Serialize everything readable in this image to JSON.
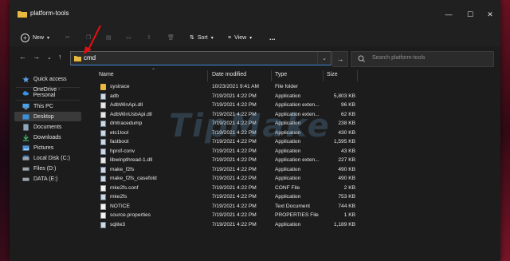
{
  "window": {
    "title": "platform-tools"
  },
  "toolbar": {
    "new_label": "New",
    "sort_label": "Sort",
    "view_label": "View",
    "more_label": "..."
  },
  "address": {
    "path": "cmd",
    "search_placeholder": "Search platform-tools"
  },
  "sidebar": {
    "items": [
      {
        "label": "Quick access",
        "icon": "star-icon"
      },
      {
        "label": "OneDrive - Personal",
        "icon": "cloud-icon"
      },
      {
        "label": "This PC",
        "icon": "pc-icon"
      },
      {
        "label": "Desktop",
        "icon": "desktop-icon"
      },
      {
        "label": "Documents",
        "icon": "documents-icon"
      },
      {
        "label": "Downloads",
        "icon": "downloads-icon"
      },
      {
        "label": "Pictures",
        "icon": "pictures-icon"
      },
      {
        "label": "Local Disk (C:)",
        "icon": "drive-icon"
      },
      {
        "label": "Files (D:)",
        "icon": "drive-icon"
      },
      {
        "label": "DATA (E:)",
        "icon": "drive-icon"
      }
    ]
  },
  "columns": {
    "name": "Name",
    "date": "Date modified",
    "type": "Type",
    "size": "Size"
  },
  "files": [
    {
      "name": "systrace",
      "date": "10/23/2021 9:41 AM",
      "type": "File folder",
      "size": "",
      "kind": "folder"
    },
    {
      "name": "adb",
      "date": "7/19/2021 4:22 PM",
      "type": "Application",
      "size": "5,803 KB",
      "kind": "exe"
    },
    {
      "name": "AdbWinApi.dll",
      "date": "7/19/2021 4:22 PM",
      "type": "Application exten...",
      "size": "96 KB",
      "kind": "dll"
    },
    {
      "name": "AdbWinUsbApi.dll",
      "date": "7/19/2021 4:22 PM",
      "type": "Application exten...",
      "size": "62 KB",
      "kind": "dll"
    },
    {
      "name": "dmtracedump",
      "date": "7/19/2021 4:22 PM",
      "type": "Application",
      "size": "238 KB",
      "kind": "exe"
    },
    {
      "name": "etc1tool",
      "date": "7/19/2021 4:22 PM",
      "type": "Application",
      "size": "430 KB",
      "kind": "exe"
    },
    {
      "name": "fastboot",
      "date": "7/19/2021 4:22 PM",
      "type": "Application",
      "size": "1,595 KB",
      "kind": "exe"
    },
    {
      "name": "hprof-conv",
      "date": "7/19/2021 4:22 PM",
      "type": "Application",
      "size": "43 KB",
      "kind": "exe"
    },
    {
      "name": "libwinpthread-1.dll",
      "date": "7/19/2021 4:22 PM",
      "type": "Application exten...",
      "size": "227 KB",
      "kind": "dll"
    },
    {
      "name": "make_f2fs",
      "date": "7/19/2021 4:22 PM",
      "type": "Application",
      "size": "490 KB",
      "kind": "exe"
    },
    {
      "name": "make_f2fs_casefold",
      "date": "7/19/2021 4:22 PM",
      "type": "Application",
      "size": "490 KB",
      "kind": "exe"
    },
    {
      "name": "mke2fs.conf",
      "date": "7/19/2021 4:22 PM",
      "type": "CONF File",
      "size": "2 KB",
      "kind": "file"
    },
    {
      "name": "mke2fs",
      "date": "7/19/2021 4:22 PM",
      "type": "Application",
      "size": "753 KB",
      "kind": "exe"
    },
    {
      "name": "NOTICE",
      "date": "7/19/2021 4:22 PM",
      "type": "Text Document",
      "size": "744 KB",
      "kind": "file"
    },
    {
      "name": "source.properties",
      "date": "7/19/2021 4:22 PM",
      "type": "PROPERTIES File",
      "size": "1 KB",
      "kind": "file"
    },
    {
      "name": "sqlite3",
      "date": "7/19/2021 4:22 PM",
      "type": "Application",
      "size": "1,189 KB",
      "kind": "exe"
    }
  ],
  "watermark": "TipMake",
  "colors": {
    "accent": "#3e8ad8",
    "annotation_arrow": "#e01010",
    "folder": "#e8b83f"
  }
}
